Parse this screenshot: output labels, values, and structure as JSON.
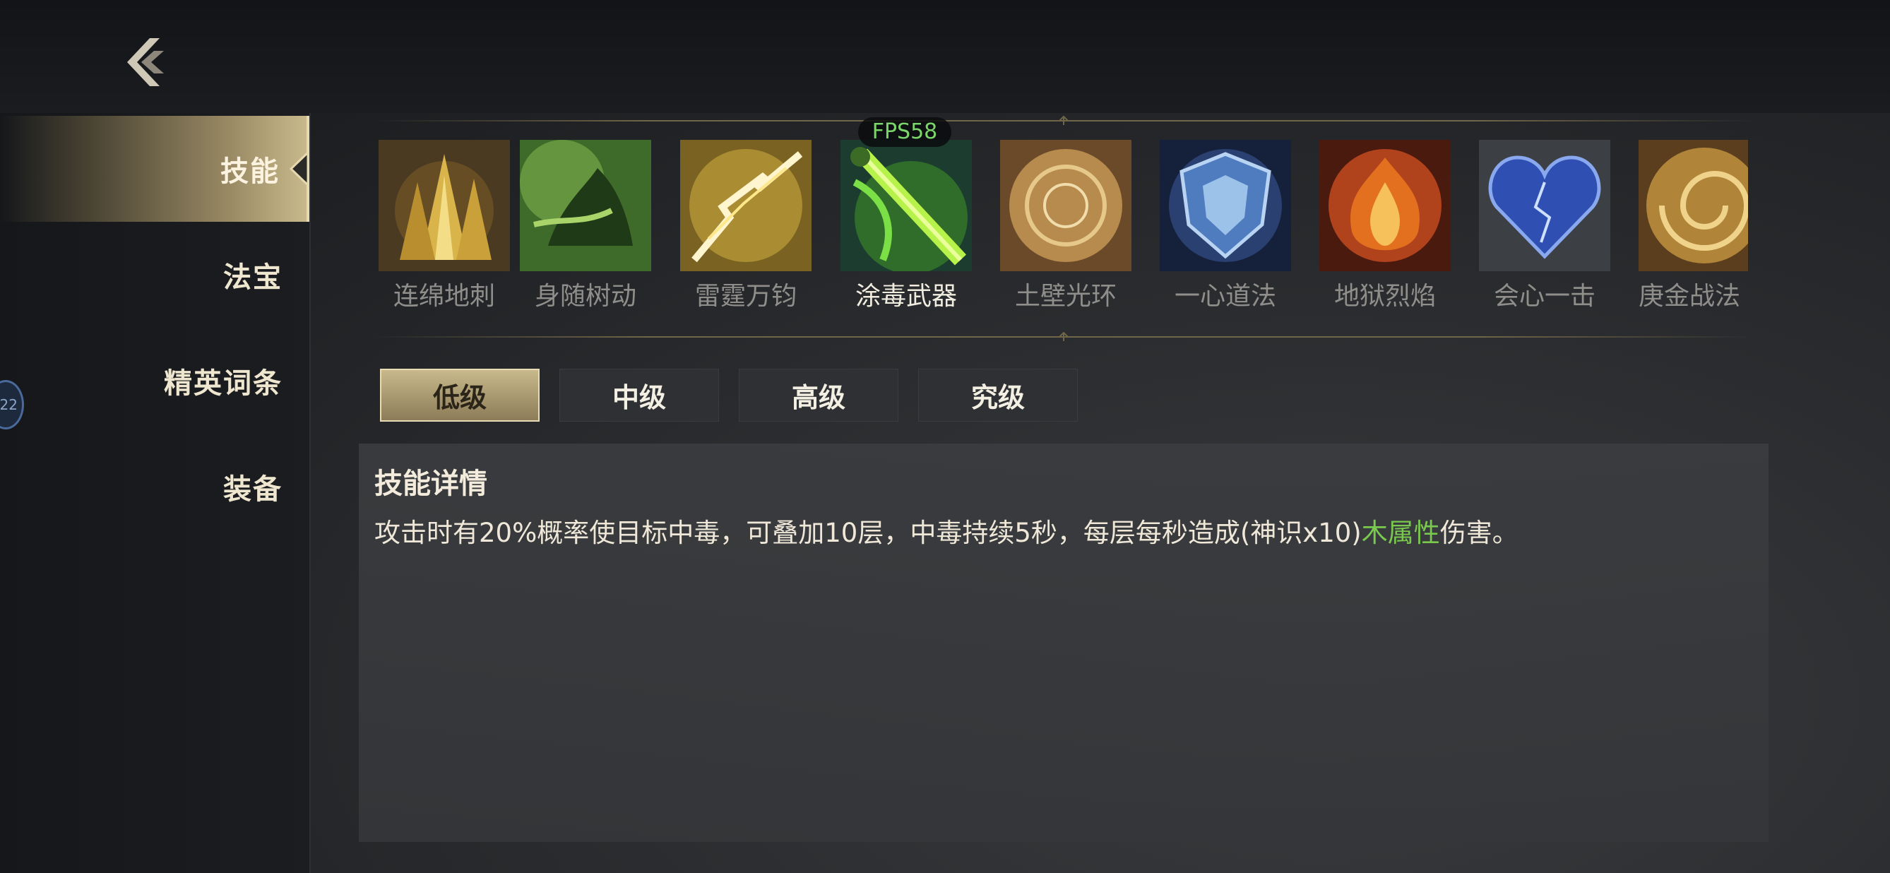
{
  "back": {
    "icon": "back-arrow-icon"
  },
  "sidebar": {
    "items": [
      {
        "label": "技能",
        "active": true
      },
      {
        "label": "法宝",
        "active": false
      },
      {
        "label": "精英词条",
        "active": false
      },
      {
        "label": "装备",
        "active": false
      }
    ],
    "badge": "22"
  },
  "fps": "FPS58",
  "skills": [
    {
      "label": "连绵地刺",
      "icon": "earth-spikes-icon"
    },
    {
      "label": "身随树动",
      "icon": "tree-leap-icon"
    },
    {
      "label": "雷霆万钧",
      "icon": "thunder-icon"
    },
    {
      "label": "涂毒武器",
      "icon": "poison-weapon-icon",
      "selected": true
    },
    {
      "label": "土壁光环",
      "icon": "earth-aura-icon"
    },
    {
      "label": "一心道法",
      "icon": "ice-shield-icon"
    },
    {
      "label": "地狱烈焰",
      "icon": "hellfire-icon"
    },
    {
      "label": "会心一击",
      "icon": "crit-heart-icon"
    },
    {
      "label": "庚金战法",
      "icon": "metal-swirl-icon"
    }
  ],
  "tiers": [
    {
      "label": "低级",
      "active": true
    },
    {
      "label": "中级",
      "active": false
    },
    {
      "label": "高级",
      "active": false
    },
    {
      "label": "究级",
      "active": false
    }
  ],
  "detail": {
    "title": "技能详情",
    "desc_before": "攻击时有20%概率使目标中毒，可叠加10层，中毒持续5秒，每层每秒造成(神识x10)",
    "desc_highlight": "木属性",
    "desc_after": "伤害。"
  },
  "colors": {
    "accent_gold": "#c8b98c",
    "highlight_green": "#7ac94f",
    "fps_green": "#7bd66a"
  }
}
